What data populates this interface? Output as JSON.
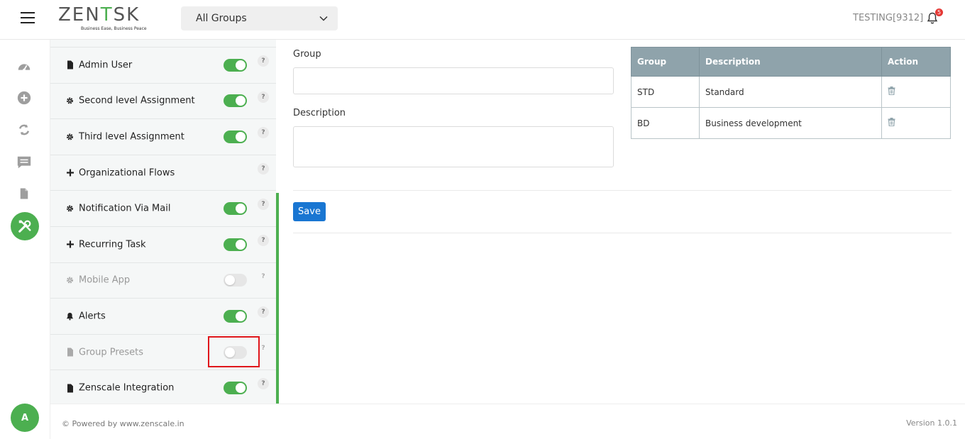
{
  "header": {
    "logo_text_left": "ZEN",
    "logo_text_accent": "T",
    "logo_text_right": "SK",
    "logo_tagline": "Business Ease, Business Peace",
    "group_select_value": "All Groups",
    "user_label": "TESTING[9312]",
    "notification_count": "5"
  },
  "leftnav": {
    "items": [
      "dashboard-icon",
      "add-icon",
      "refresh-icon",
      "chat-icon",
      "document-icon",
      "tools-icon"
    ],
    "avatar_letter": "A"
  },
  "settings": {
    "items": [
      {
        "label": "Admin User",
        "icon": "file-icon",
        "toggle": "on",
        "disabled": false
      },
      {
        "label": "Second level Assignment",
        "icon": "gear-icon",
        "toggle": "on",
        "disabled": false
      },
      {
        "label": "Third level Assignment",
        "icon": "gear-icon",
        "toggle": "on",
        "disabled": false
      },
      {
        "label": "Organizational Flows",
        "icon": "plus-icon",
        "toggle": "none",
        "disabled": false
      },
      {
        "label": "Notification Via Mail",
        "icon": "gear-icon",
        "toggle": "on",
        "disabled": false
      },
      {
        "label": "Recurring Task",
        "icon": "plus-icon",
        "toggle": "on",
        "disabled": false
      },
      {
        "label": "Mobile App",
        "icon": "gear-icon",
        "toggle": "off",
        "disabled": true
      },
      {
        "label": "Alerts",
        "icon": "bell-icon",
        "toggle": "on",
        "disabled": false
      },
      {
        "label": "Group Presets",
        "icon": "file-icon",
        "toggle": "off",
        "disabled": true
      },
      {
        "label": "Zenscale Integration",
        "icon": "file-icon",
        "toggle": "on",
        "disabled": false
      }
    ],
    "help_label": "?"
  },
  "form": {
    "group_label": "Group",
    "group_value": "",
    "description_label": "Description",
    "description_value": "",
    "save_label": "Save"
  },
  "table": {
    "headers": [
      "Group",
      "Description",
      "Action"
    ],
    "rows": [
      {
        "group": "STD",
        "description": "Standard"
      },
      {
        "group": "BD",
        "description": "Business development"
      }
    ]
  },
  "footer": {
    "powered": "© Powered by www.zenscale.in",
    "version": "Version 1.0.1"
  },
  "colors": {
    "accent_green": "#4caf50",
    "save_blue": "#1976d2",
    "table_header": "#8fa3ab",
    "highlight_red": "#e0161b"
  }
}
